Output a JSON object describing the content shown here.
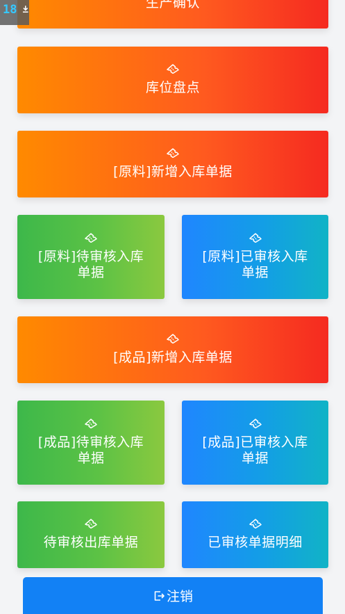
{
  "status_overlay": {
    "number": "18",
    "icon": "download-icon"
  },
  "menu": {
    "production_confirm": {
      "label": "生产确认",
      "icon": "ticket-icon"
    },
    "stock_take": {
      "label": "库位盘点",
      "icon": "ticket-icon"
    },
    "raw_new_inbound": {
      "label": "[原料]新增入库单据",
      "icon": "ticket-icon"
    },
    "raw_pending_inbound": {
      "label": "[原料]待审核入库单据",
      "icon": "ticket-icon"
    },
    "raw_approved_inbound": {
      "label": "[原料]已审核入库单据",
      "icon": "ticket-icon"
    },
    "finished_new_inbound": {
      "label": "[成品]新增入库单据",
      "icon": "ticket-icon"
    },
    "finished_pending_inbound": {
      "label": "[成品]待审核入库单据",
      "icon": "ticket-icon"
    },
    "finished_approved_inbound": {
      "label": "[成品]已审核入库单据",
      "icon": "ticket-icon"
    },
    "pending_outbound": {
      "label": "待审核出库单据",
      "icon": "ticket-icon"
    },
    "approved_details": {
      "label": "已审核单据明细",
      "icon": "ticket-icon"
    }
  },
  "logout": {
    "label": "注销",
    "icon": "logout-icon"
  },
  "colors": {
    "orange_start": "#ff8a00",
    "orange_end": "#f52a20",
    "green_start": "#3db84a",
    "green_end": "#8bc93f",
    "blue_start": "#1f86ff",
    "blue_end": "#11b3c6",
    "logout_bg": "#1281f5",
    "background": "#f3f4f6"
  }
}
